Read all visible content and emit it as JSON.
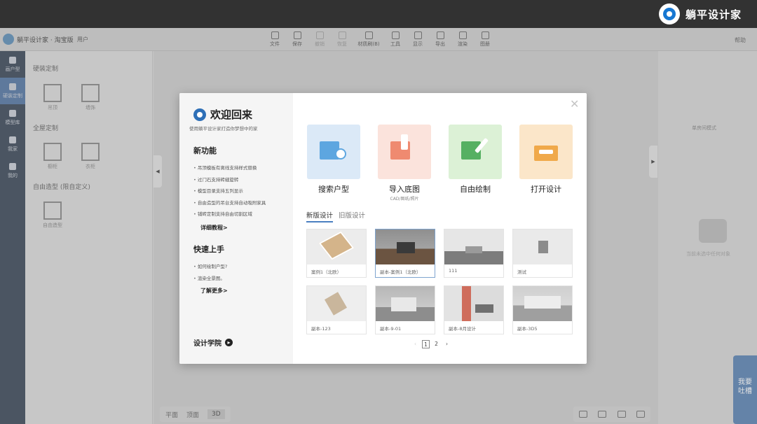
{
  "banner": {
    "brand": "躺平设计家"
  },
  "app": {
    "title": "躺平设计家 · 淘宝版",
    "user": "用户",
    "help": "帮助",
    "toolbar": [
      {
        "label": "文件",
        "faint": false
      },
      {
        "label": "保存",
        "faint": false
      },
      {
        "label": "撤销",
        "faint": true
      },
      {
        "label": "恢复",
        "faint": true
      },
      {
        "label": "材质刷(B)",
        "faint": false
      },
      {
        "label": "工具",
        "faint": false
      },
      {
        "label": "显示",
        "faint": false
      },
      {
        "label": "导出",
        "faint": false
      },
      {
        "label": "渲染",
        "faint": false
      },
      {
        "label": "图册",
        "faint": false
      }
    ],
    "nav": [
      "画户型",
      "硬装定制",
      "模型库",
      "我家",
      "我的"
    ],
    "left_panel": {
      "section1": "硬装定制",
      "tiles1": [
        "吊顶",
        "墙饰"
      ],
      "section2": "全屋定制",
      "tiles2": [
        "橱柜",
        "衣柜"
      ],
      "section3": "自由造型   (限自定义)",
      "tiles3": [
        "自由造型"
      ]
    },
    "right_panel": {
      "title": "单房间模式",
      "hint": "当前未选中任何对象"
    },
    "view_modes": [
      "平面",
      "顶面",
      "3D"
    ],
    "active_view": "3D",
    "feedback": [
      "我要",
      "吐槽"
    ]
  },
  "modal": {
    "title": "欢迎回来",
    "subtitle": "使用躺平设计家打造你梦想中的家",
    "new_features_heading": "新功能",
    "new_features": [
      "吊顶模板有离线支持样式替换",
      "过门石支持砖缝旋转",
      "模型目录支持五列显示",
      "自由造型的吊台支持自动吸附家具",
      "铺砖定制支持自由切割区域"
    ],
    "detail_link": "详细教程>",
    "quick_start_heading": "快速上手",
    "quick_start": [
      "如何绘制户型?",
      "渲染全景图。"
    ],
    "more_link": "了解更多>",
    "academy": "设计学院",
    "close": "✕",
    "actions": [
      {
        "label": "搜索户型",
        "sub": ""
      },
      {
        "label": "导入底图",
        "sub": "CAD/图纸/照片"
      },
      {
        "label": "自由绘制",
        "sub": ""
      },
      {
        "label": "打开设计",
        "sub": ""
      }
    ],
    "tabs": [
      "新版设计",
      "旧版设计"
    ],
    "designs": [
      "案例1（北欧）",
      "副本-案例1（北欧）",
      "111",
      "测试",
      "副本-123",
      "副本-9-01",
      "副本-8月设计",
      "副本-3D5"
    ],
    "pagination": {
      "prev": "‹",
      "pages": [
        "1",
        "2"
      ],
      "next": "›",
      "current": "1"
    }
  },
  "colors": {
    "accent": "#2e6fb7",
    "tile_search": "#dbe9f7",
    "tile_import": "#fbe3dc",
    "tile_draw": "#dcf1d6",
    "tile_open": "#fbe6c9"
  }
}
